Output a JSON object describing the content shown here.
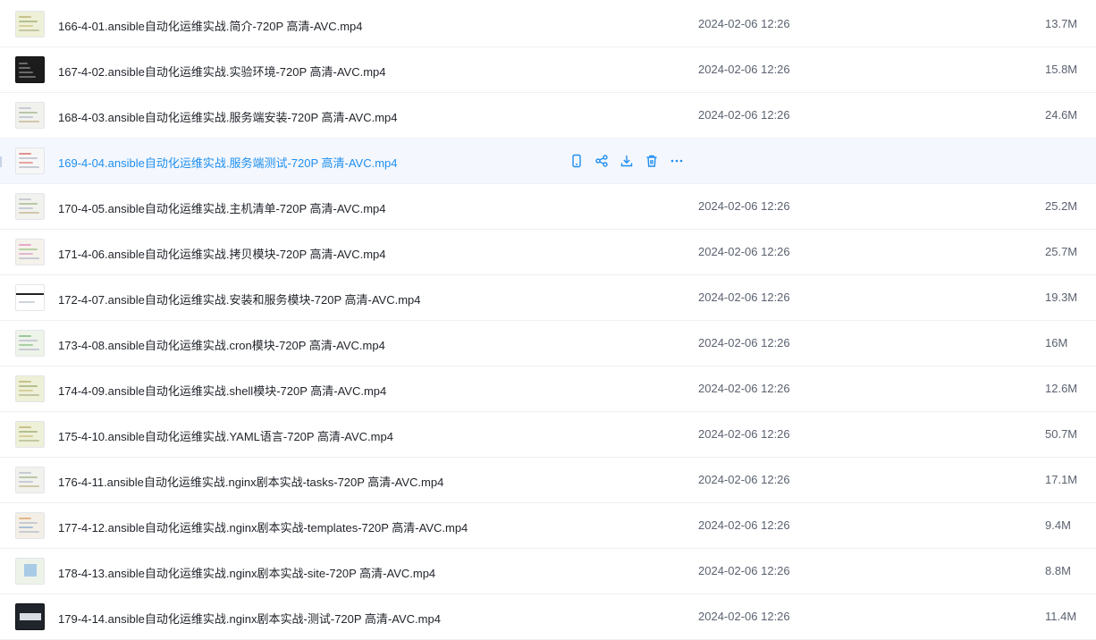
{
  "colors": {
    "accent": "#1f8ff0",
    "row_hover_bg": "#f4f7fd",
    "text": "#1f2329",
    "muted": "#5b6270"
  },
  "files": [
    {
      "name": "166-4-01.ansible自动化运维实战.简介-720P 高清-AVC.mp4",
      "date": "2024-02-06 12:26",
      "size": "13.7M",
      "thumb": "light-yellow"
    },
    {
      "name": "167-4-02.ansible自动化运维实战.实验环境-720P 高清-AVC.mp4",
      "date": "2024-02-06 12:26",
      "size": "15.8M",
      "thumb": "dark-terminal"
    },
    {
      "name": "168-4-03.ansible自动化运维实战.服务端安装-720P 高清-AVC.mp4",
      "date": "2024-02-06 12:26",
      "size": "24.6M",
      "thumb": "light-lines"
    },
    {
      "name": "169-4-04.ansible自动化运维实战.服务端测试-720P 高清-AVC.mp4",
      "date": "",
      "size": "",
      "thumb": "light-red-lines",
      "hovered": true
    },
    {
      "name": "170-4-05.ansible自动化运维实战.主机清单-720P 高清-AVC.mp4",
      "date": "2024-02-06 12:26",
      "size": "25.2M",
      "thumb": "light-lines"
    },
    {
      "name": "171-4-06.ansible自动化运维实战.拷贝模块-720P 高清-AVC.mp4",
      "date": "2024-02-06 12:26",
      "size": "25.7M",
      "thumb": "light-pink-lines"
    },
    {
      "name": "172-4-07.ansible自动化运维实战.安装和服务模块-720P 高清-AVC.mp4",
      "date": "2024-02-06 12:26",
      "size": "19.3M",
      "thumb": "white-black-bar"
    },
    {
      "name": "173-4-08.ansible自动化运维实战.cron模块-720P 高清-AVC.mp4",
      "date": "2024-02-06 12:26",
      "size": "16M",
      "thumb": "light-green-lines"
    },
    {
      "name": "174-4-09.ansible自动化运维实战.shell模块-720P 高清-AVC.mp4",
      "date": "2024-02-06 12:26",
      "size": "12.6M",
      "thumb": "light-yellow"
    },
    {
      "name": "175-4-10.ansible自动化运维实战.YAML语言-720P 高清-AVC.mp4",
      "date": "2024-02-06 12:26",
      "size": "50.7M",
      "thumb": "light-yellow"
    },
    {
      "name": "176-4-11.ansible自动化运维实战.nginx剧本实战-tasks-720P 高清-AVC.mp4",
      "date": "2024-02-06 12:26",
      "size": "17.1M",
      "thumb": "light-lines"
    },
    {
      "name": "177-4-12.ansible自动化运维实战.nginx剧本实战-templates-720P 高清-AVC.mp4",
      "date": "2024-02-06 12:26",
      "size": "9.4M",
      "thumb": "light-orange-lines"
    },
    {
      "name": "178-4-13.ansible自动化运维实战.nginx剧本实战-site-720P 高清-AVC.mp4",
      "date": "2024-02-06 12:26",
      "size": "8.8M",
      "thumb": "light-blue-window"
    },
    {
      "name": "179-4-14.ansible自动化运维实战.nginx剧本实战-测试-720P 高清-AVC.mp4",
      "date": "2024-02-06 12:26",
      "size": "11.4M",
      "thumb": "dark-screen"
    }
  ],
  "hover_actions": [
    {
      "id": "phone",
      "icon": "phone-icon",
      "label": "phone"
    },
    {
      "id": "share",
      "icon": "share-icon",
      "label": "share"
    },
    {
      "id": "download",
      "icon": "download-icon",
      "label": "download"
    },
    {
      "id": "delete",
      "icon": "trash-icon",
      "label": "delete"
    },
    {
      "id": "more",
      "icon": "more-icon",
      "label": "more"
    }
  ]
}
